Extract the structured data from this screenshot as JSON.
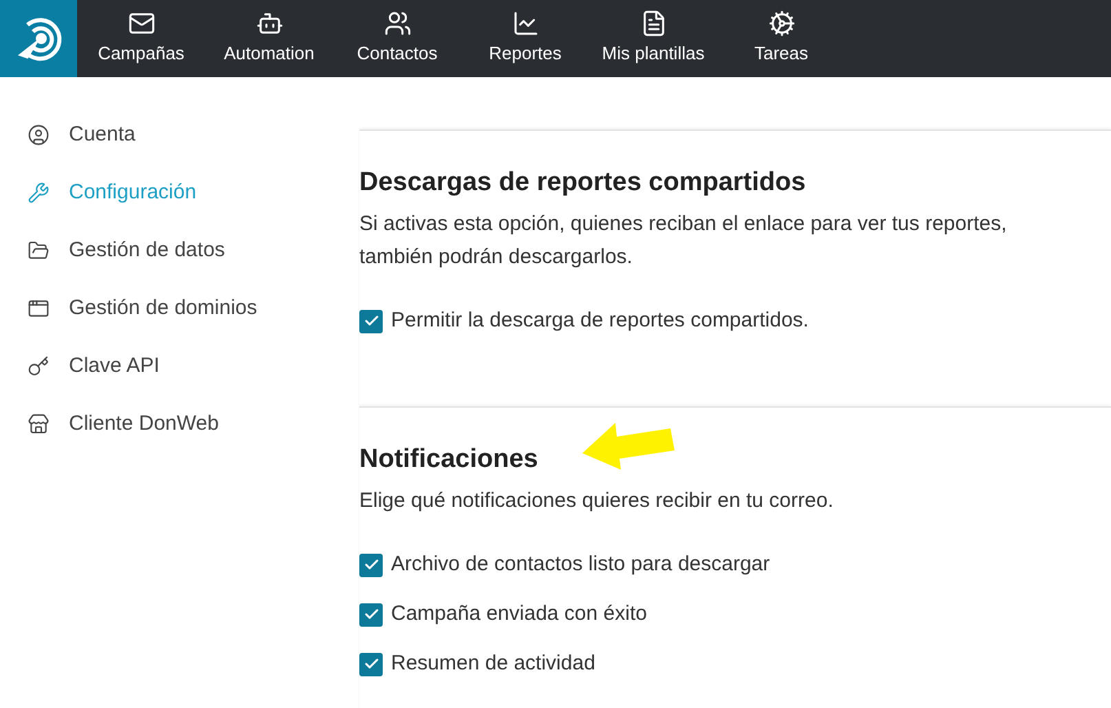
{
  "nav": [
    {
      "label": "Campañas"
    },
    {
      "label": "Automation"
    },
    {
      "label": "Contactos"
    },
    {
      "label": "Reportes"
    },
    {
      "label": "Mis plantillas"
    },
    {
      "label": "Tareas"
    }
  ],
  "sidebar": {
    "items": [
      {
        "label": "Cuenta",
        "selected": false
      },
      {
        "label": "Configuración",
        "selected": true
      },
      {
        "label": "Gestión de datos",
        "selected": false
      },
      {
        "label": "Gestión de dominios",
        "selected": false
      },
      {
        "label": "Clave API",
        "selected": false
      },
      {
        "label": "Cliente DonWeb",
        "selected": false
      }
    ]
  },
  "sections": [
    {
      "title": "Descargas de reportes compartidos",
      "description": "Si activas esta opción, quienes reciban el enlace para ver tus reportes, también podrán descargarlos.",
      "options": [
        {
          "label": "Permitir la descarga de reportes compartidos.",
          "checked": true
        }
      ]
    },
    {
      "title": "Notificaciones",
      "description": "Elige qué notificaciones quieres recibir en tu correo.",
      "options": [
        {
          "label": "Archivo de contactos listo para descargar",
          "checked": true
        },
        {
          "label": "Campaña enviada con éxito",
          "checked": true
        },
        {
          "label": "Resumen de actividad",
          "checked": true
        }
      ]
    }
  ]
}
